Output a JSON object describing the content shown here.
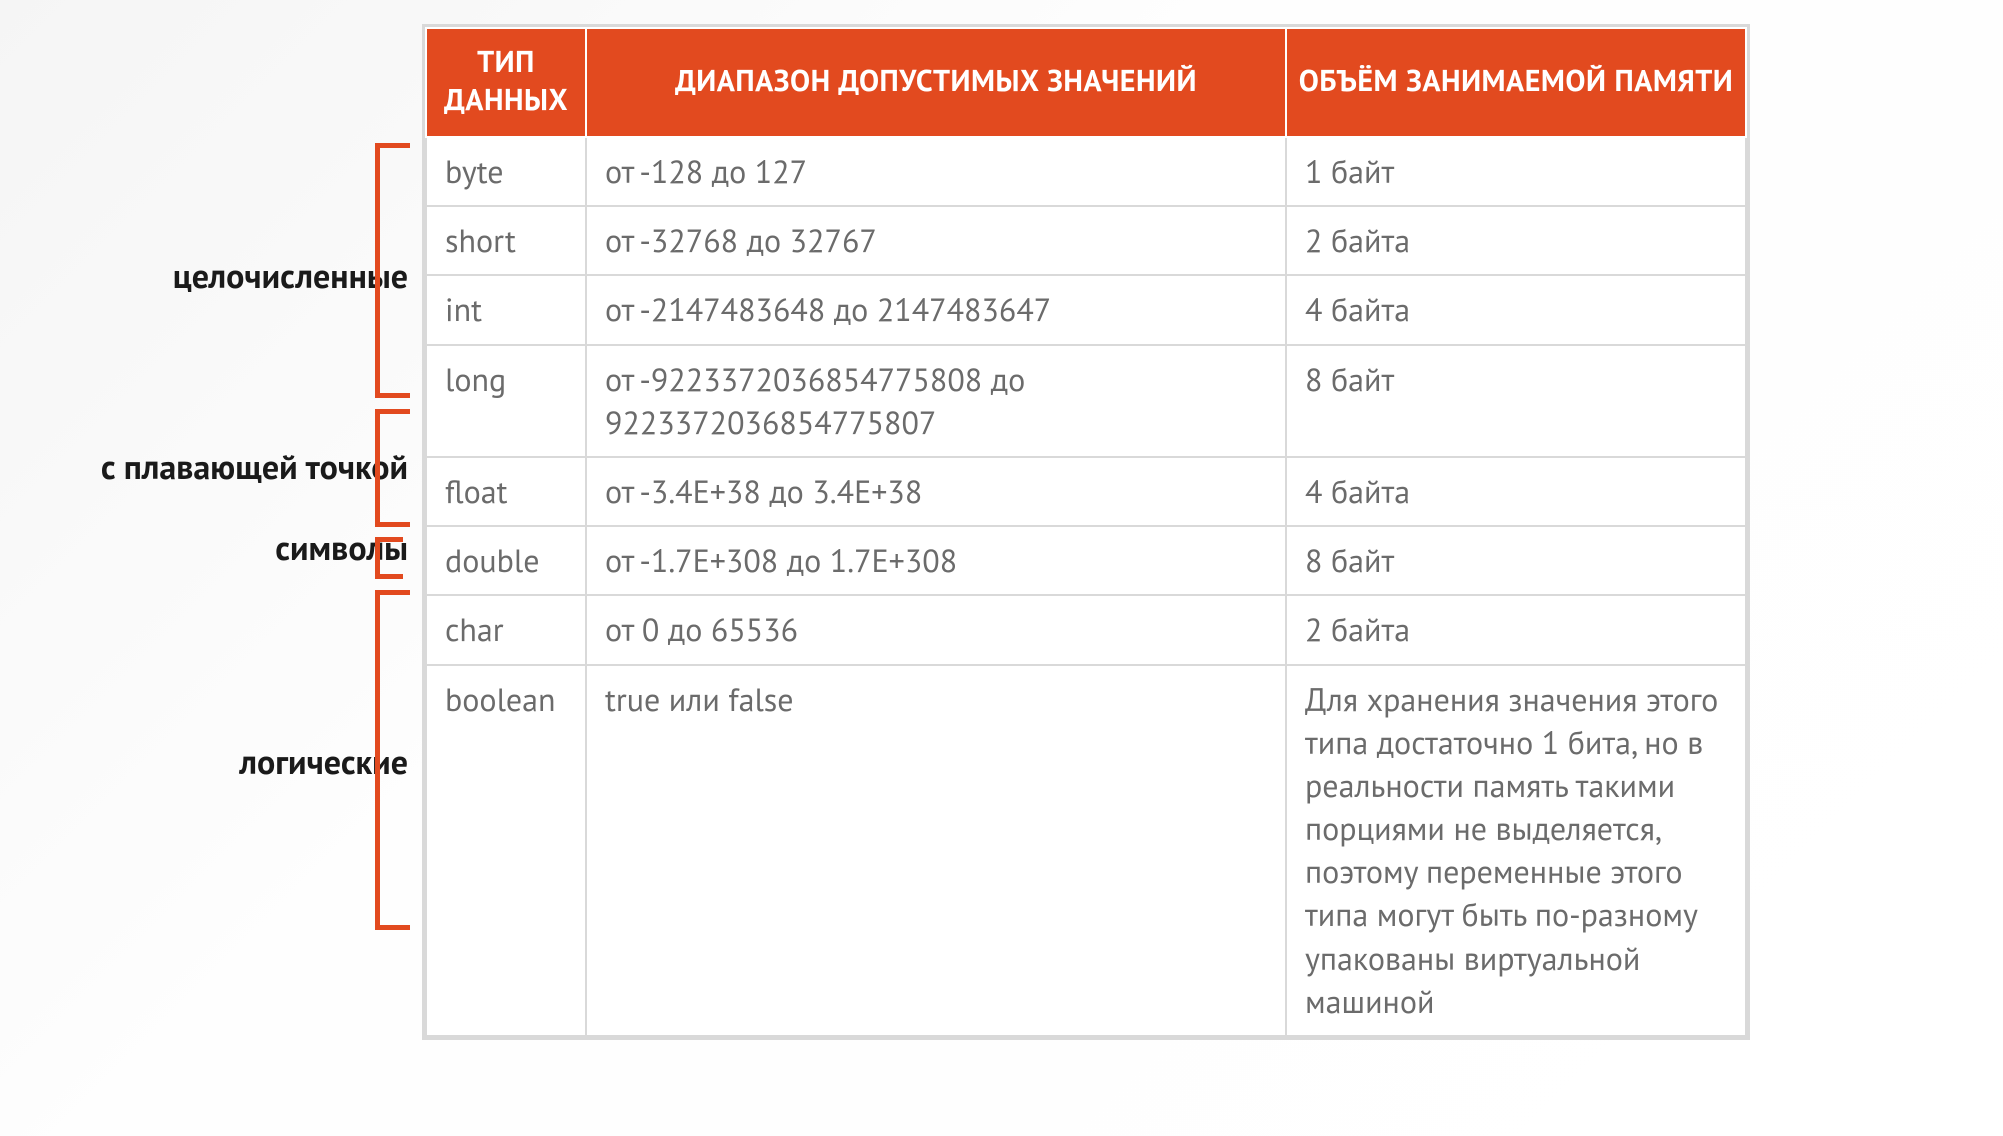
{
  "columns": {
    "type": "ТИП ДАННЫХ",
    "range": "ДИАПАЗОН ДОПУСТИМЫХ ЗНАЧЕНИЙ",
    "memory": "ОБЪЁМ ЗАНИМАЕМОЙ ПАМЯТИ"
  },
  "groups": {
    "integer": "целочисленные",
    "floating": "с плавающей точкой",
    "chars": "символы",
    "logical": "логические"
  },
  "rows": [
    {
      "type": "byte",
      "range": "от -128 до 127",
      "memory": "1 байт"
    },
    {
      "type": "short",
      "range": "от -32768 до 32767",
      "memory": "2 байта"
    },
    {
      "type": "int",
      "range": "от -2147483648 до 2147483647",
      "memory": "4 байта"
    },
    {
      "type": "long",
      "range": "от -9223372036854775808 до 9223372036854775807",
      "memory": "8 байт"
    },
    {
      "type": "float",
      "range": "от -3.4E+38 до 3.4E+38",
      "memory": "4 байта"
    },
    {
      "type": "double",
      "range": "от -1.7E+308 до 1.7E+308",
      "memory": "8 байт"
    },
    {
      "type": "char",
      "range": "от 0 до 65536",
      "memory": "2 байта"
    },
    {
      "type": "boolean",
      "range": "true или false",
      "memory": "Для хранения значения этого типа достаточно 1 бита, но в реальности память такими порциями не выделяется, поэтому переменные этого типа могут быть по-разному упакованы виртуальной машиной"
    }
  ],
  "colors": {
    "accent": "#e24a1f",
    "border": "#d9d9d9",
    "text": "#6b6b6b"
  }
}
